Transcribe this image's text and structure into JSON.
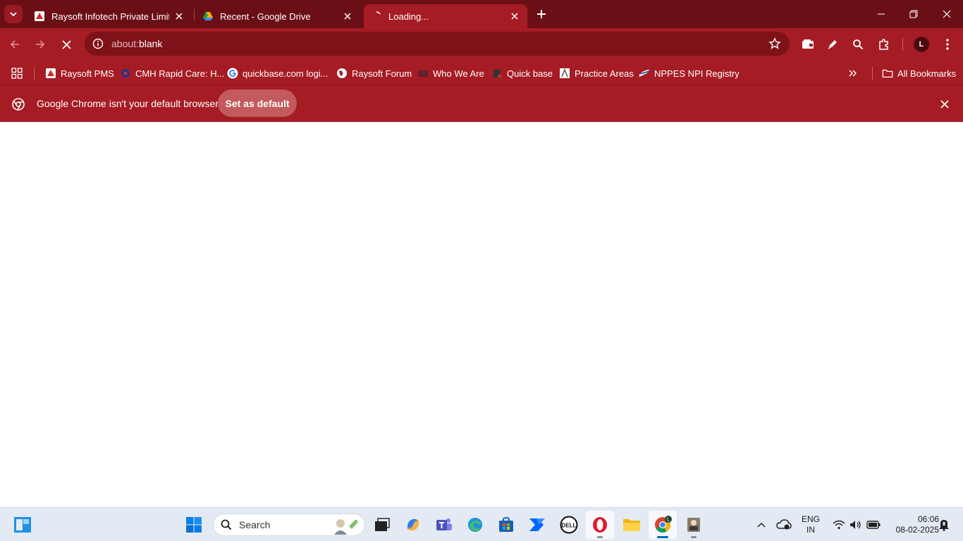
{
  "tabs": [
    {
      "title": "Raysoft Infotech Private Limited",
      "active": false
    },
    {
      "title": "Recent - Google Drive",
      "active": false
    },
    {
      "title": "Loading...",
      "active": true
    }
  ],
  "toolbar": {
    "url_prefix": "about:",
    "url_main": "blank"
  },
  "bookmarks": [
    {
      "label": "Raysoft PMS"
    },
    {
      "label": "CMH Rapid Care: H..."
    },
    {
      "label": "quickbase.com logi..."
    },
    {
      "label": "Raysoft Forum"
    },
    {
      "label": "Who We Are"
    },
    {
      "label": "Quick base"
    },
    {
      "label": "Practice Areas"
    },
    {
      "label": "NPPES NPI Registry"
    }
  ],
  "all_bookmarks": "All Bookmarks",
  "profile_initial": "L",
  "infobar": {
    "message": "Google Chrome isn't your default browser",
    "button": "Set as default"
  },
  "taskbar": {
    "search_label": "Search",
    "lang_top": "ENG",
    "lang_bottom": "IN",
    "time": "06:06",
    "date": "08-02-2025"
  },
  "colors": {
    "tabstrip": "#6b0f17",
    "toolbar": "#a51c24",
    "omnibox": "#7f1219"
  }
}
